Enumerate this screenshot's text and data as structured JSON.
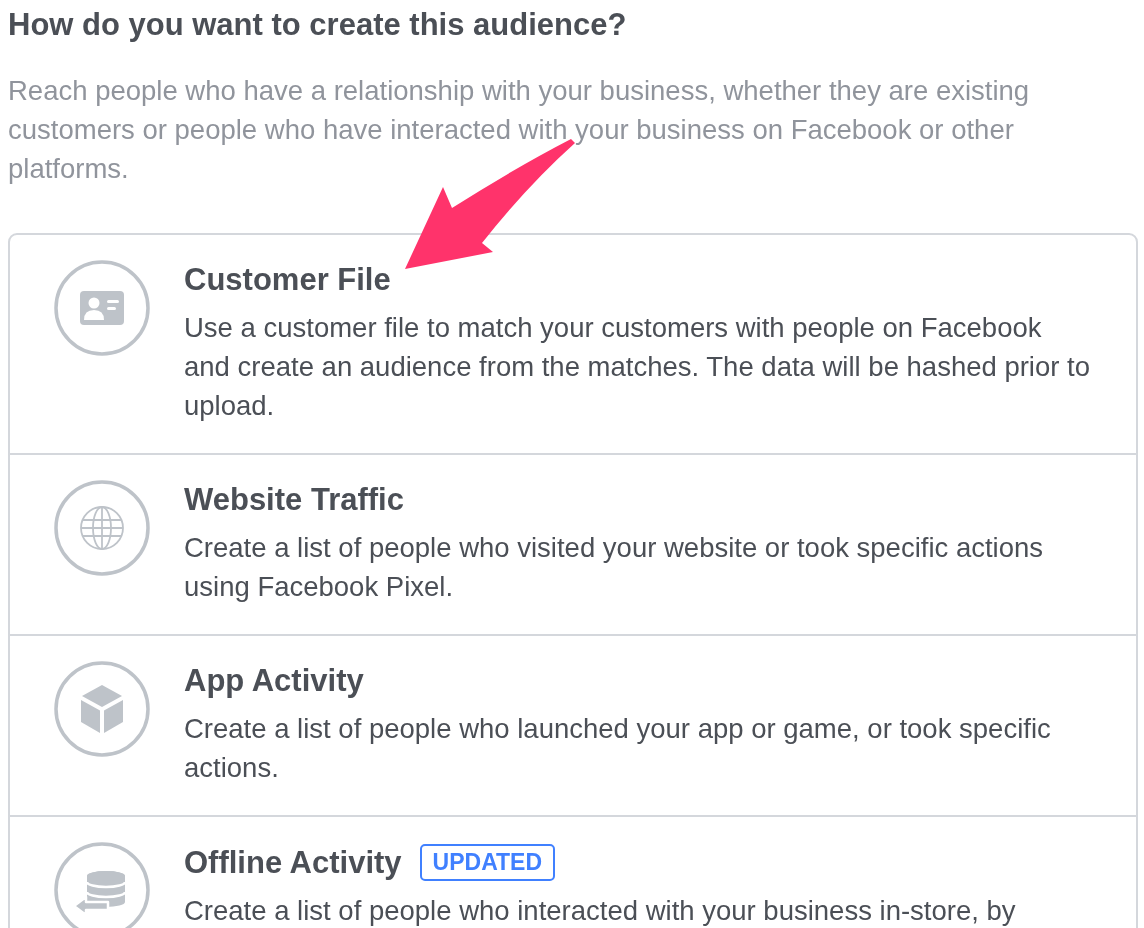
{
  "heading": "How do you want to create this audience?",
  "intro": "Reach people who have a relationship with your business, whether they are existing customers or people who have interacted with your business on Facebook or other platforms.",
  "options": [
    {
      "kind": "file",
      "title": "Customer File",
      "description": "Use a customer file to match your customers with people on Facebook and create an audience from the matches. The data will be hashed prior to upload."
    },
    {
      "kind": "website",
      "title": "Website Traffic",
      "description": "Create a list of people who visited your website or took specific actions using Facebook Pixel."
    },
    {
      "kind": "app",
      "title": "App Activity",
      "description": "Create a list of people who launched your app or game, or took specific actions."
    },
    {
      "kind": "offline",
      "title": "Offline Activity",
      "badge": "UPDATED",
      "description": "Create a list of people who interacted with your business in-store, by"
    }
  ]
}
